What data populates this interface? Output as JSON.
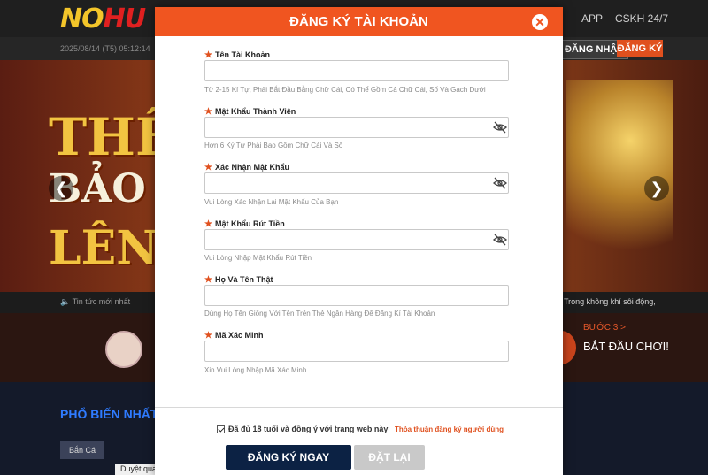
{
  "site": {
    "logo_text_1": "NO",
    "logo_text_2": "HU",
    "nav_app": "APP",
    "nav_cskh": "CSKH 24/7",
    "datetime": "2025/08/14 (T5) 05:12:14",
    "login_label": "ĐĂNG NHẬP",
    "register_label": "ĐĂNG KÝ",
    "banner_line_1": "THỂ T",
    "banner_line_2": "BẢO H",
    "banner_line_3": "LÊN Đ",
    "ticker_label": "Tin tức mới nhất",
    "ticker_right": "Trong không khí sôi động,",
    "step3_title": "BƯỚC 3 >",
    "step3_text": "BẮT ĐẦU CHƠI!",
    "popular_title": "PHỔ BIẾN NHẤT",
    "tab_fish": "Bắn Cá",
    "history_tab": "Duyệt qua lịch sử"
  },
  "modal": {
    "title": "ĐĂNG KÝ TÀI KHOẢN",
    "close_icon": "close-icon",
    "fields": [
      {
        "label": "Tên Tài Khoản",
        "value": "",
        "hint": "Từ 2-15 Kí Tự, Phải Bắt Đầu Bằng Chữ Cái, Có Thể Gồm Cả Chữ Cái, Số Và Gạch Dưới",
        "icon": ""
      },
      {
        "label": "Mật Khẩu Thành Viên",
        "value": "",
        "hint": "Hơn 6 Ký Tự Phải Bao Gồm Chữ Cái Và Số",
        "icon": "eye-off-icon"
      },
      {
        "label": "Xác Nhận Mật Khẩu",
        "value": "",
        "hint": "Vui Lòng Xác Nhận Lại Mật Khẩu Của Bạn",
        "icon": "eye-off-icon"
      },
      {
        "label": "Mật Khẩu Rút Tiền",
        "value": "",
        "hint": "Vui Lòng Nhập Mật Khẩu Rút Tiền",
        "icon": "eye-off-icon"
      },
      {
        "label": "Họ Và Tên Thật",
        "value": "",
        "hint": "Dùng Họ Tên Giống Với Tên Trên Thẻ Ngân Hàng Để Đăng Kí Tài Khoản",
        "icon": ""
      },
      {
        "label": "Mã Xác Minh",
        "value": "",
        "hint": "Xin Vui Lòng Nhập Mã Xác Minh",
        "icon": ""
      }
    ],
    "agree_checked": true,
    "agree_text": "Đã đủ 18 tuổi và đồng ý với trang web này",
    "agree_link": "Thỏa thuận đăng ký người dùng",
    "submit_label": "ĐĂNG KÝ NGAY",
    "reset_label": "ĐẶT LẠI"
  },
  "colors": {
    "accent": "#f05520",
    "submit_bg": "#0c2244",
    "reset_bg": "#c9c9c9"
  }
}
